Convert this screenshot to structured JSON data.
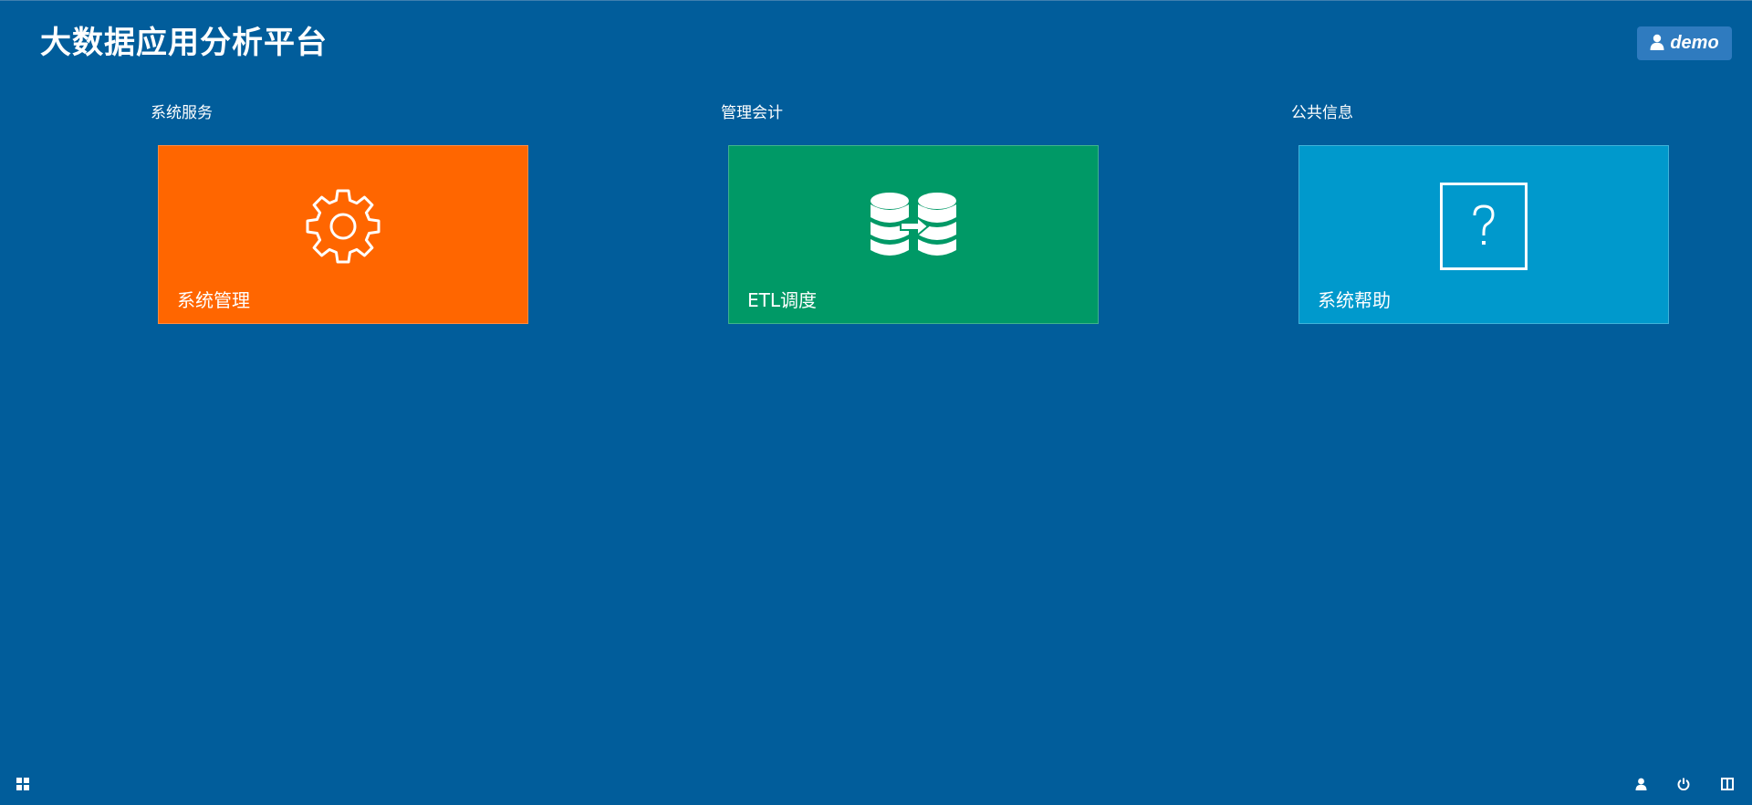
{
  "header": {
    "app_title": "大数据应用分析平台",
    "user_label": "demo",
    "user_icon": "user-icon"
  },
  "sections": [
    {
      "title": "系统服务",
      "tile": {
        "label": "系统管理",
        "icon": "gear-icon",
        "color": "#ff6600"
      }
    },
    {
      "title": "管理会计",
      "tile": {
        "label": "ETL调度",
        "icon": "database-transfer-icon",
        "color": "#009966"
      }
    },
    {
      "title": "公共信息",
      "tile": {
        "label": "系统帮助",
        "icon": "help-icon",
        "color": "#0099cc"
      }
    }
  ],
  "footer": {
    "left_icon": "start-menu-icon",
    "right_icons": [
      "user-icon",
      "power-icon",
      "split-view-icon"
    ]
  },
  "colors": {
    "background": "#015d9b",
    "user_button": "#2f7bbf"
  }
}
